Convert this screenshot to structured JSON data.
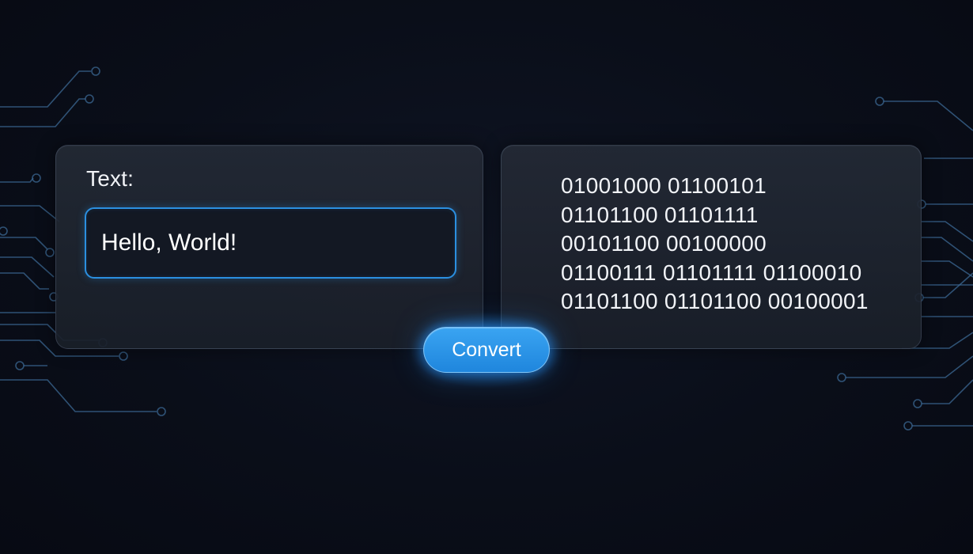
{
  "input_panel": {
    "label": "Text:",
    "value": "Hello, World!",
    "placeholder": ""
  },
  "convert_button": {
    "label": "Convert"
  },
  "output_panel": {
    "lines": [
      "01001000 01100101",
      "01101100 01101111",
      "00101100 00100000",
      "01100111 01101111 01100010",
      "01101100 01101100 00100001"
    ]
  },
  "colors": {
    "background": "#090d17",
    "panel": "#1f2430",
    "accent": "#2b8fe0",
    "button": "#2a95e8",
    "circuit": "#3c6a96",
    "text": "#f1f3f7"
  }
}
